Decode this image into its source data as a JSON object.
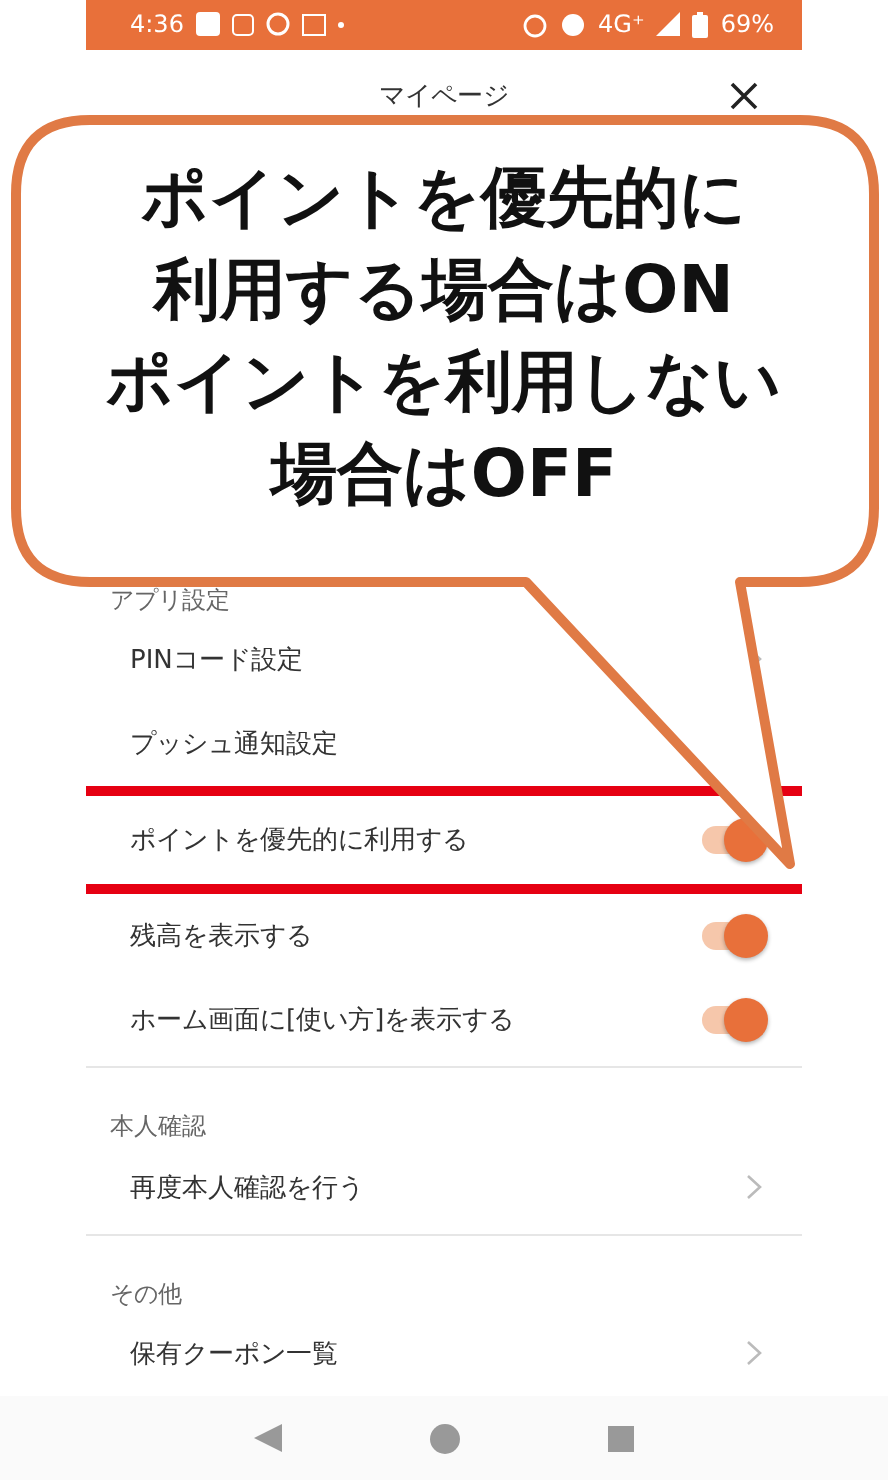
{
  "status_bar": {
    "time": "4:36",
    "network": "4G⁺",
    "battery": "69%"
  },
  "header": {
    "title": "マイページ"
  },
  "sections": [
    {
      "title": "アプリ設定",
      "rows": [
        {
          "label": "PINコード設定",
          "kind": "link",
          "highlighted": false
        },
        {
          "label": "プッシュ通知設定",
          "kind": "plain",
          "highlighted": false
        },
        {
          "label": "ポイントを優先的に利用する",
          "kind": "toggle",
          "on": true,
          "highlighted": true
        },
        {
          "label": "残高を表示する",
          "kind": "toggle",
          "on": true,
          "highlighted": false
        },
        {
          "label": "ホーム画面に[使い方]を表示する",
          "kind": "toggle",
          "on": true,
          "highlighted": false
        }
      ]
    },
    {
      "title": "本人確認",
      "rows": [
        {
          "label": "再度本人確認を行う",
          "kind": "link",
          "highlighted": false
        }
      ]
    },
    {
      "title": "その他",
      "rows": [
        {
          "label": "保有クーポン一覧",
          "kind": "link",
          "highlighted": false
        }
      ]
    }
  ],
  "callout": {
    "lines": [
      "ポイントを優先的に",
      "利用する場合はON",
      "ポイントを利用しない",
      "場合はOFF"
    ]
  }
}
